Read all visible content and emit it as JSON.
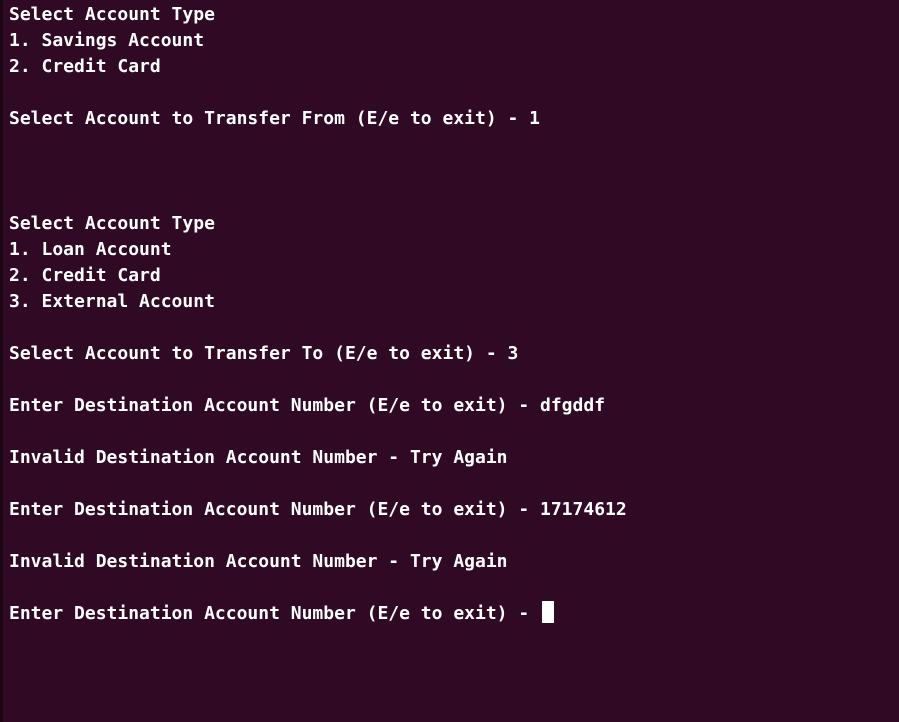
{
  "terminal": {
    "lines": [
      "Select Account Type",
      "1. Savings Account",
      "2. Credit Card",
      "Select Account to Transfer From (E/e to exit) - 1",
      "Select Account Type",
      "1. Loan Account",
      "2. Credit Card",
      "3. External Account",
      "Select Account to Transfer To (E/e to exit) - 3",
      "Enter Destination Account Number (E/e to exit) - dfgddf",
      "Invalid Destination Account Number - Try Again",
      "Enter Destination Account Number (E/e to exit) - 17174612",
      "Invalid Destination Account Number - Try Again",
      "Enter Destination Account Number (E/e to exit) - "
    ],
    "colors": {
      "background": "#300a24",
      "foreground": "#ffffff"
    }
  }
}
